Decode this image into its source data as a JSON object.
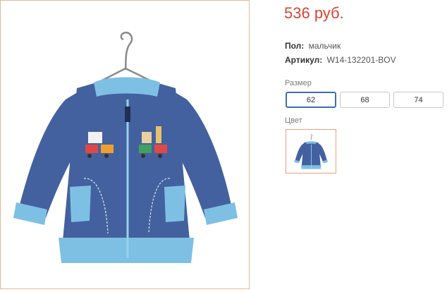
{
  "product": {
    "price": "536 руб.",
    "gender_label": "Пол:",
    "gender_value": "мальчик",
    "sku_label": "Артикул:",
    "sku_value": "W14-132201-BOV"
  },
  "size": {
    "label": "Размер",
    "options": [
      "62",
      "68",
      "74"
    ],
    "selected": "62"
  },
  "color": {
    "label": "Цвет",
    "swatch_icon": "jacket-thumbnail"
  },
  "colors": {
    "price": "#d64535",
    "selected_border": "#3b6fb6",
    "photo_border": "#e7b894",
    "jacket_body": "#44619f",
    "jacket_trim": "#7ec0e4"
  }
}
